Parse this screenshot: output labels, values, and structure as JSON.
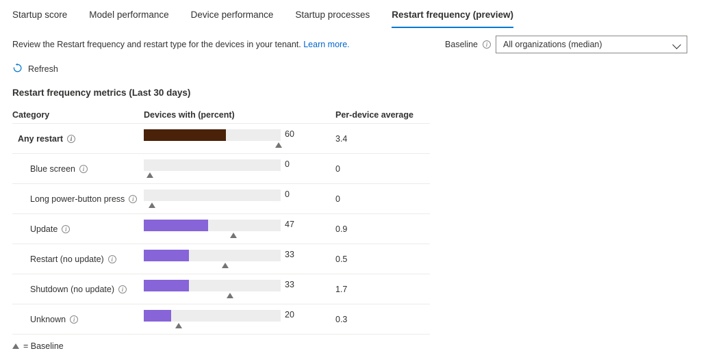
{
  "tabs": [
    {
      "label": "Startup score",
      "selected": false
    },
    {
      "label": "Model performance",
      "selected": false
    },
    {
      "label": "Device performance",
      "selected": false
    },
    {
      "label": "Startup processes",
      "selected": false
    },
    {
      "label": "Restart frequency (preview)",
      "selected": true
    }
  ],
  "description": {
    "text": "Review the Restart frequency and restart type for the devices in your tenant.",
    "link_label": "Learn more."
  },
  "baseline": {
    "label": "Baseline",
    "info_icon": "info-icon",
    "selected_option": "All organizations (median)",
    "options": [
      "All organizations (median)"
    ],
    "chevron_icon": "chevron-down-icon"
  },
  "toolbar": {
    "refresh_label": "Refresh",
    "refresh_icon": "refresh-icon"
  },
  "section": {
    "title": "Restart frequency metrics (Last 30 days)"
  },
  "table": {
    "columns": [
      "Category",
      "Devices with (percent)",
      "Per-device average"
    ],
    "rows": [
      {
        "category": "Any restart",
        "indent": false,
        "percent": 60,
        "baseline_percent": 98.5,
        "average": "3.4",
        "bar_color": "#4a2209",
        "info_icon": "info-icon"
      },
      {
        "category": "Blue screen",
        "indent": true,
        "percent": 0,
        "baseline_percent": 4.5,
        "average": "0",
        "bar_color": "#8764d8",
        "info_icon": "info-icon"
      },
      {
        "category": "Long power-button press",
        "indent": true,
        "percent": 0,
        "baseline_percent": 6.0,
        "average": "0",
        "bar_color": "#8764d8",
        "info_icon": "info-icon"
      },
      {
        "category": "Update",
        "indent": true,
        "percent": 47,
        "baseline_percent": 65.5,
        "average": "0.9",
        "bar_color": "#8764d8",
        "info_icon": "info-icon"
      },
      {
        "category": "Restart (no update)",
        "indent": true,
        "percent": 33,
        "baseline_percent": 59.5,
        "average": "0.5",
        "bar_color": "#8764d8",
        "info_icon": "info-icon"
      },
      {
        "category": "Shutdown (no update)",
        "indent": true,
        "percent": 33,
        "baseline_percent": 63.0,
        "average": "1.7",
        "bar_color": "#8764d8",
        "info_icon": "info-icon"
      },
      {
        "category": "Unknown",
        "indent": true,
        "percent": 20,
        "baseline_percent": 25.5,
        "average": "0.3",
        "bar_color": "#8764d8",
        "info_icon": "info-icon"
      }
    ]
  },
  "legend": {
    "baseline_label": "= Baseline",
    "marker_icon": "triangle-marker-icon"
  },
  "colors": {
    "accent": "#0078d4",
    "link": "#0066cc",
    "bar_purple": "#8764d8",
    "bar_dark": "#4a2209",
    "track": "#ededed",
    "marker": "#767472"
  },
  "chart_data": {
    "type": "bar",
    "title": "Restart frequency metrics (Last 30 days)",
    "xlabel": "Devices with (percent)",
    "ylabel": "Category",
    "xlim": [
      0,
      100
    ],
    "grid": false,
    "legend": "= Baseline",
    "categories": [
      "Any restart",
      "Blue screen",
      "Long power-button press",
      "Update",
      "Restart (no update)",
      "Shutdown (no update)",
      "Unknown"
    ],
    "series": [
      {
        "name": "Devices with (percent)",
        "values": [
          60,
          0,
          0,
          47,
          33,
          33,
          20
        ]
      },
      {
        "name": "Baseline (All organizations median, percent)",
        "values": [
          98.5,
          4.5,
          6.0,
          65.5,
          59.5,
          63.0,
          25.5
        ]
      },
      {
        "name": "Per-device average",
        "values": [
          3.4,
          0,
          0,
          0.9,
          0.5,
          1.7,
          0.3
        ]
      }
    ]
  }
}
